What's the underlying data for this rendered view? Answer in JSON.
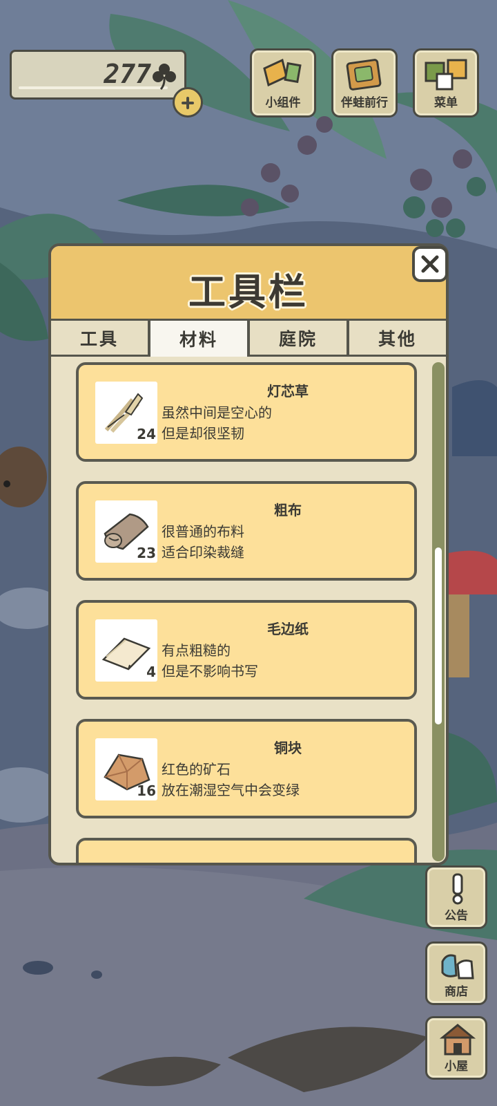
{
  "currency": {
    "count": "277",
    "icon": "clover-icon",
    "add_icon": "plus-icon"
  },
  "top_buttons": [
    {
      "label": "小组件",
      "icon": "widget-icon"
    },
    {
      "label": "伴蛙前行",
      "icon": "frog-companion-icon"
    },
    {
      "label": "菜单",
      "icon": "menu-icon"
    }
  ],
  "side_buttons": [
    {
      "label": "公告",
      "icon": "exclamation-icon"
    },
    {
      "label": "商店",
      "icon": "shop-icon"
    },
    {
      "label": "小屋",
      "icon": "house-icon"
    }
  ],
  "panel": {
    "title": "工具栏",
    "close_icon": "close-icon",
    "tabs": [
      {
        "label": "工具",
        "active": false
      },
      {
        "label": "材料",
        "active": true
      },
      {
        "label": "庭院",
        "active": false
      },
      {
        "label": "其他",
        "active": false
      }
    ],
    "items": [
      {
        "name": "灯芯草",
        "qty": "24",
        "desc1": "虽然中间是空心的",
        "desc2": "但是却很坚韧",
        "icon": "rush-bundle-icon"
      },
      {
        "name": "粗布",
        "qty": "23",
        "desc1": "很普通的布料",
        "desc2": "适合印染裁缝",
        "icon": "cloth-roll-icon"
      },
      {
        "name": "毛边纸",
        "qty": "4",
        "desc1": "有点粗糙的",
        "desc2": "但是不影响书写",
        "icon": "paper-stack-icon"
      },
      {
        "name": "铜块",
        "qty": "16",
        "desc1": "红色的矿石",
        "desc2": "放在潮湿空气中会变绿",
        "icon": "copper-ore-icon"
      }
    ]
  },
  "colors": {
    "panel_header": "#ecc56e",
    "card": "#fde09a",
    "panel_bg": "#e9e1c6",
    "scene": "#5b6a83"
  }
}
